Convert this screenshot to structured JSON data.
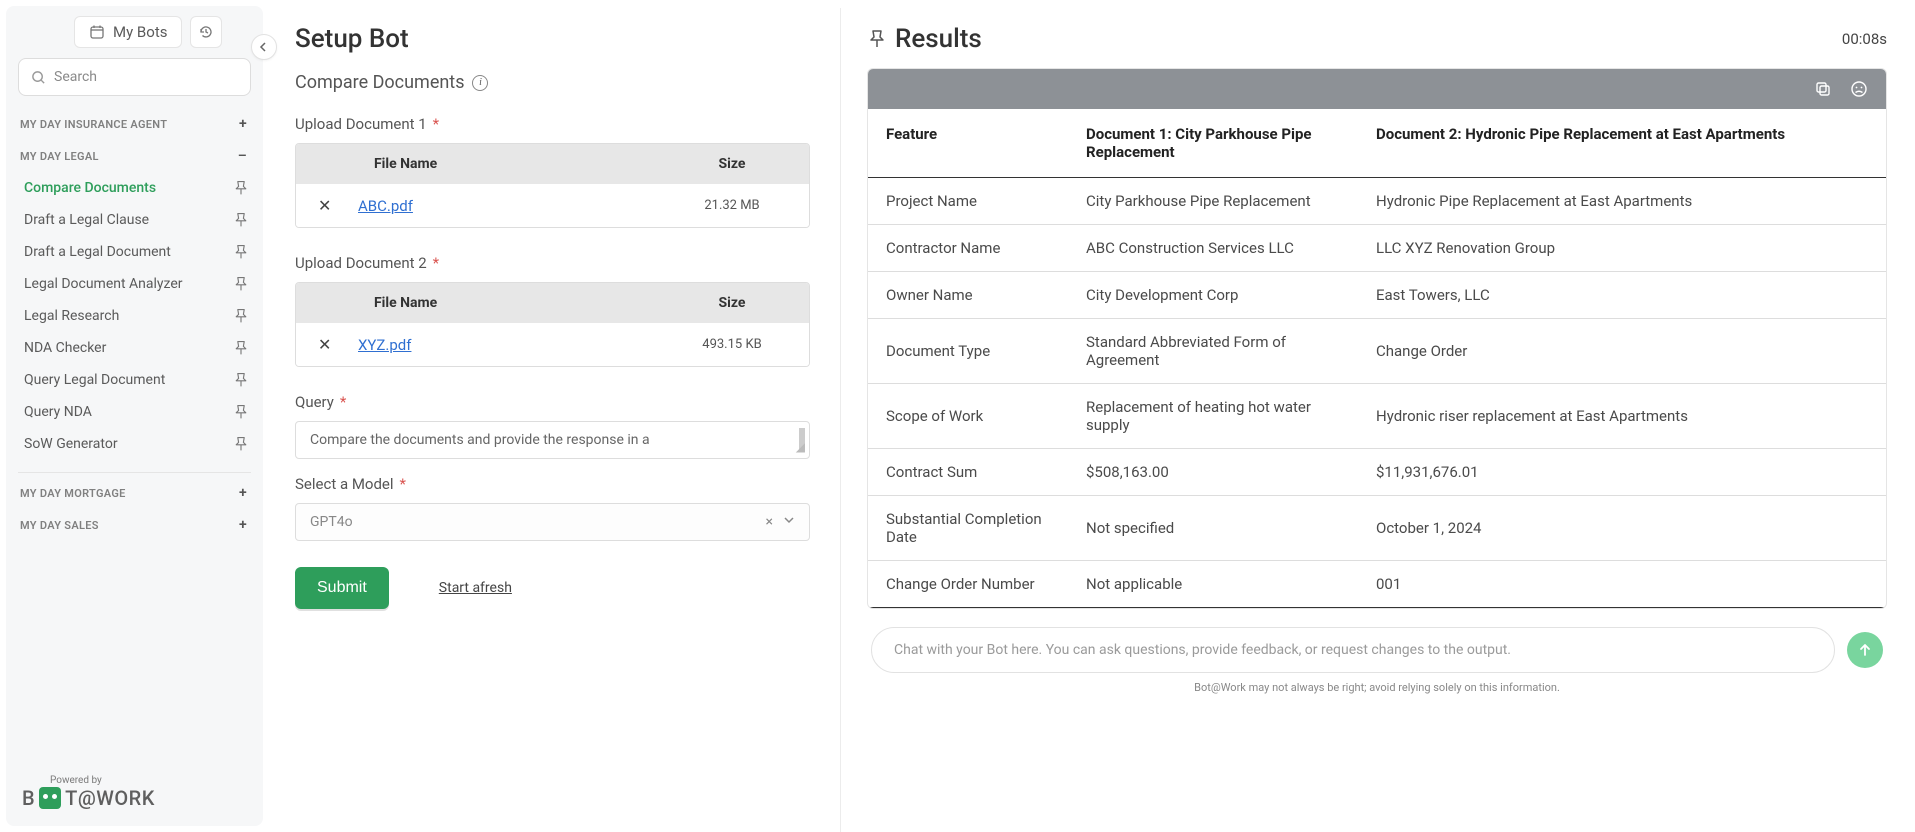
{
  "sidebar": {
    "tab_active": "My Bots",
    "search_placeholder": "Search",
    "sections": [
      {
        "name": "MY DAY INSURANCE AGENT",
        "expanded": false,
        "items": []
      },
      {
        "name": "MY DAY LEGAL",
        "expanded": true,
        "items": [
          {
            "label": "Compare Documents",
            "active": true
          },
          {
            "label": "Draft a Legal Clause",
            "active": false
          },
          {
            "label": "Draft a Legal Document",
            "active": false
          },
          {
            "label": "Legal Document Analyzer",
            "active": false
          },
          {
            "label": "Legal Research",
            "active": false
          },
          {
            "label": "NDA Checker",
            "active": false
          },
          {
            "label": "Query Legal Document",
            "active": false
          },
          {
            "label": "Query NDA",
            "active": false
          },
          {
            "label": "SoW Generator",
            "active": false
          }
        ]
      },
      {
        "name": "MY DAY MORTGAGE",
        "expanded": false,
        "items": []
      },
      {
        "name": "MY DAY SALES",
        "expanded": false,
        "items": []
      }
    ],
    "powered_label": "Powered by",
    "brand_pre": "B",
    "brand_post": "T@WORK"
  },
  "setup": {
    "title": "Setup Bot",
    "subtitle": "Compare Documents",
    "upload1_label": "Upload Document 1",
    "upload2_label": "Upload Document 2",
    "col_file": "File Name",
    "col_size": "Size",
    "file1": {
      "name": "ABC.pdf",
      "size": "21.32 MB"
    },
    "file2": {
      "name": "XYZ.pdf",
      "size": "493.15 KB"
    },
    "query_label": "Query",
    "query_value": "Compare the documents and provide the response in a",
    "model_label": "Select a Model",
    "model_value": "GPT4o",
    "submit_label": "Submit",
    "start_afresh_label": "Start afresh"
  },
  "results": {
    "title": "Results",
    "timer": "00:08s",
    "headers": [
      "Feature",
      "Document 1: City Parkhouse Pipe Replacement",
      "Document 2: Hydronic Pipe Replacement at East Apartments"
    ],
    "rows": [
      [
        "Project Name",
        "City Parkhouse Pipe Replacement",
        "Hydronic Pipe Replacement at East Apartments"
      ],
      [
        "Contractor Name",
        "ABC Construction Services LLC",
        "LLC XYZ Renovation Group"
      ],
      [
        "Owner Name",
        "City Development Corp",
        "East Towers, LLC"
      ],
      [
        "Document Type",
        "Standard Abbreviated Form of Agreement",
        "Change Order"
      ],
      [
        "Scope of Work",
        "Replacement of heating hot water supply",
        "Hydronic riser replacement at East Apartments"
      ],
      [
        "Contract Sum",
        "$508,163.00",
        "$11,931,676.01"
      ],
      [
        "Substantial Completion Date",
        "Not specified",
        "October 1, 2024"
      ],
      [
        "Change Order Number",
        "Not applicable",
        "001"
      ]
    ],
    "chat_placeholder": "Chat with your Bot here. You can ask questions, provide feedback, or request changes to the output.",
    "disclaimer": "Bot@Work may not always be right; avoid relying solely on this information."
  }
}
